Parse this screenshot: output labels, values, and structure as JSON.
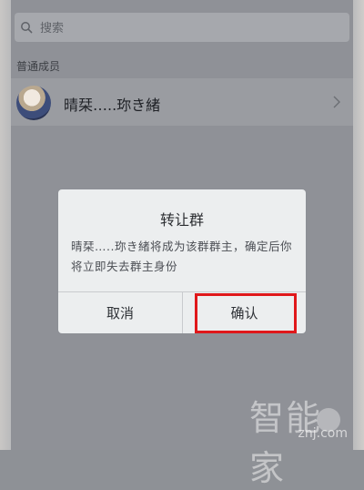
{
  "search": {
    "placeholder": "搜索"
  },
  "members_section": {
    "label": "普通成员"
  },
  "members": [
    {
      "name": "晴栞…..珎き緒"
    }
  ],
  "dialog": {
    "title": "转让群",
    "message": "晴栞…..珎き緒将成为该群群主，确定后你将立即失去群主身份",
    "cancel_label": "取消",
    "confirm_label": "确认"
  },
  "watermark": {
    "text": "智能家",
    "domain": "znj.com"
  },
  "colors": {
    "highlight": "#e0181b"
  }
}
